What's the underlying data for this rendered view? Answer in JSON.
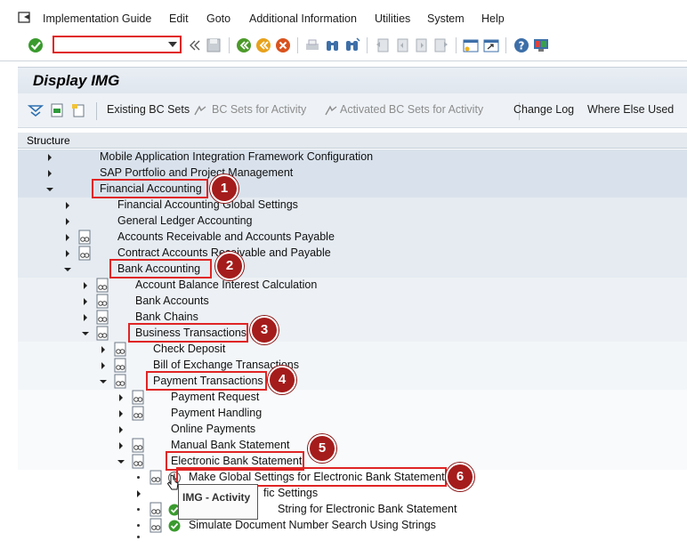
{
  "menu": {
    "items": [
      "Implementation Guide",
      "Edit",
      "Goto",
      "Additional Information",
      "Utilities",
      "System",
      "Help"
    ]
  },
  "toolbar": {
    "command_value": "",
    "icons": [
      "enter-icon",
      "save-icon",
      "back-icon",
      "exit-icon",
      "cancel-icon",
      "print-icon",
      "find-icon",
      "find-next-icon",
      "first-page-icon",
      "prev-page-icon",
      "next-page-icon",
      "last-page-icon",
      "new-session-icon",
      "shortcut-icon",
      "help-icon",
      "layout-icon"
    ]
  },
  "screen": {
    "title": "Display IMG"
  },
  "app_toolbar": {
    "existing_bc_sets": "Existing BC Sets",
    "bc_sets_activity": "BC Sets for Activity",
    "activated_bc_sets": "Activated BC Sets for Activity",
    "change_log": "Change Log",
    "where_else_used": "Where Else Used"
  },
  "tree": {
    "header": "Structure",
    "rows": [
      "Mobile Application Integration Framework Configuration",
      "SAP Portfolio and Project Management",
      "Financial Accounting",
      "Financial Accounting Global Settings",
      "General Ledger Accounting",
      "Accounts Receivable and Accounts Payable",
      "Contract Accounts Receivable and Payable",
      "Bank Accounting",
      "Account Balance Interest Calculation",
      "Bank Accounts",
      "Bank Chains",
      "Business Transactions",
      "Check Deposit",
      "Bill of Exchange Transactions",
      "Payment Transactions",
      "Payment Request",
      "Payment Handling",
      "Online Payments",
      "Manual Bank Statement",
      "Electronic Bank Statement",
      "Make Global Settings for Electronic Bank Statement",
      "fic Settings",
      "String for Electronic Bank Statement",
      "Simulate Document Number Search Using Strings"
    ]
  },
  "badges": [
    "1",
    "2",
    "3",
    "4",
    "5",
    "6"
  ],
  "tooltip": "IMG - Activity",
  "colors": {
    "highlight_border": "#e02424",
    "badge_fill": "#a51c1c"
  }
}
